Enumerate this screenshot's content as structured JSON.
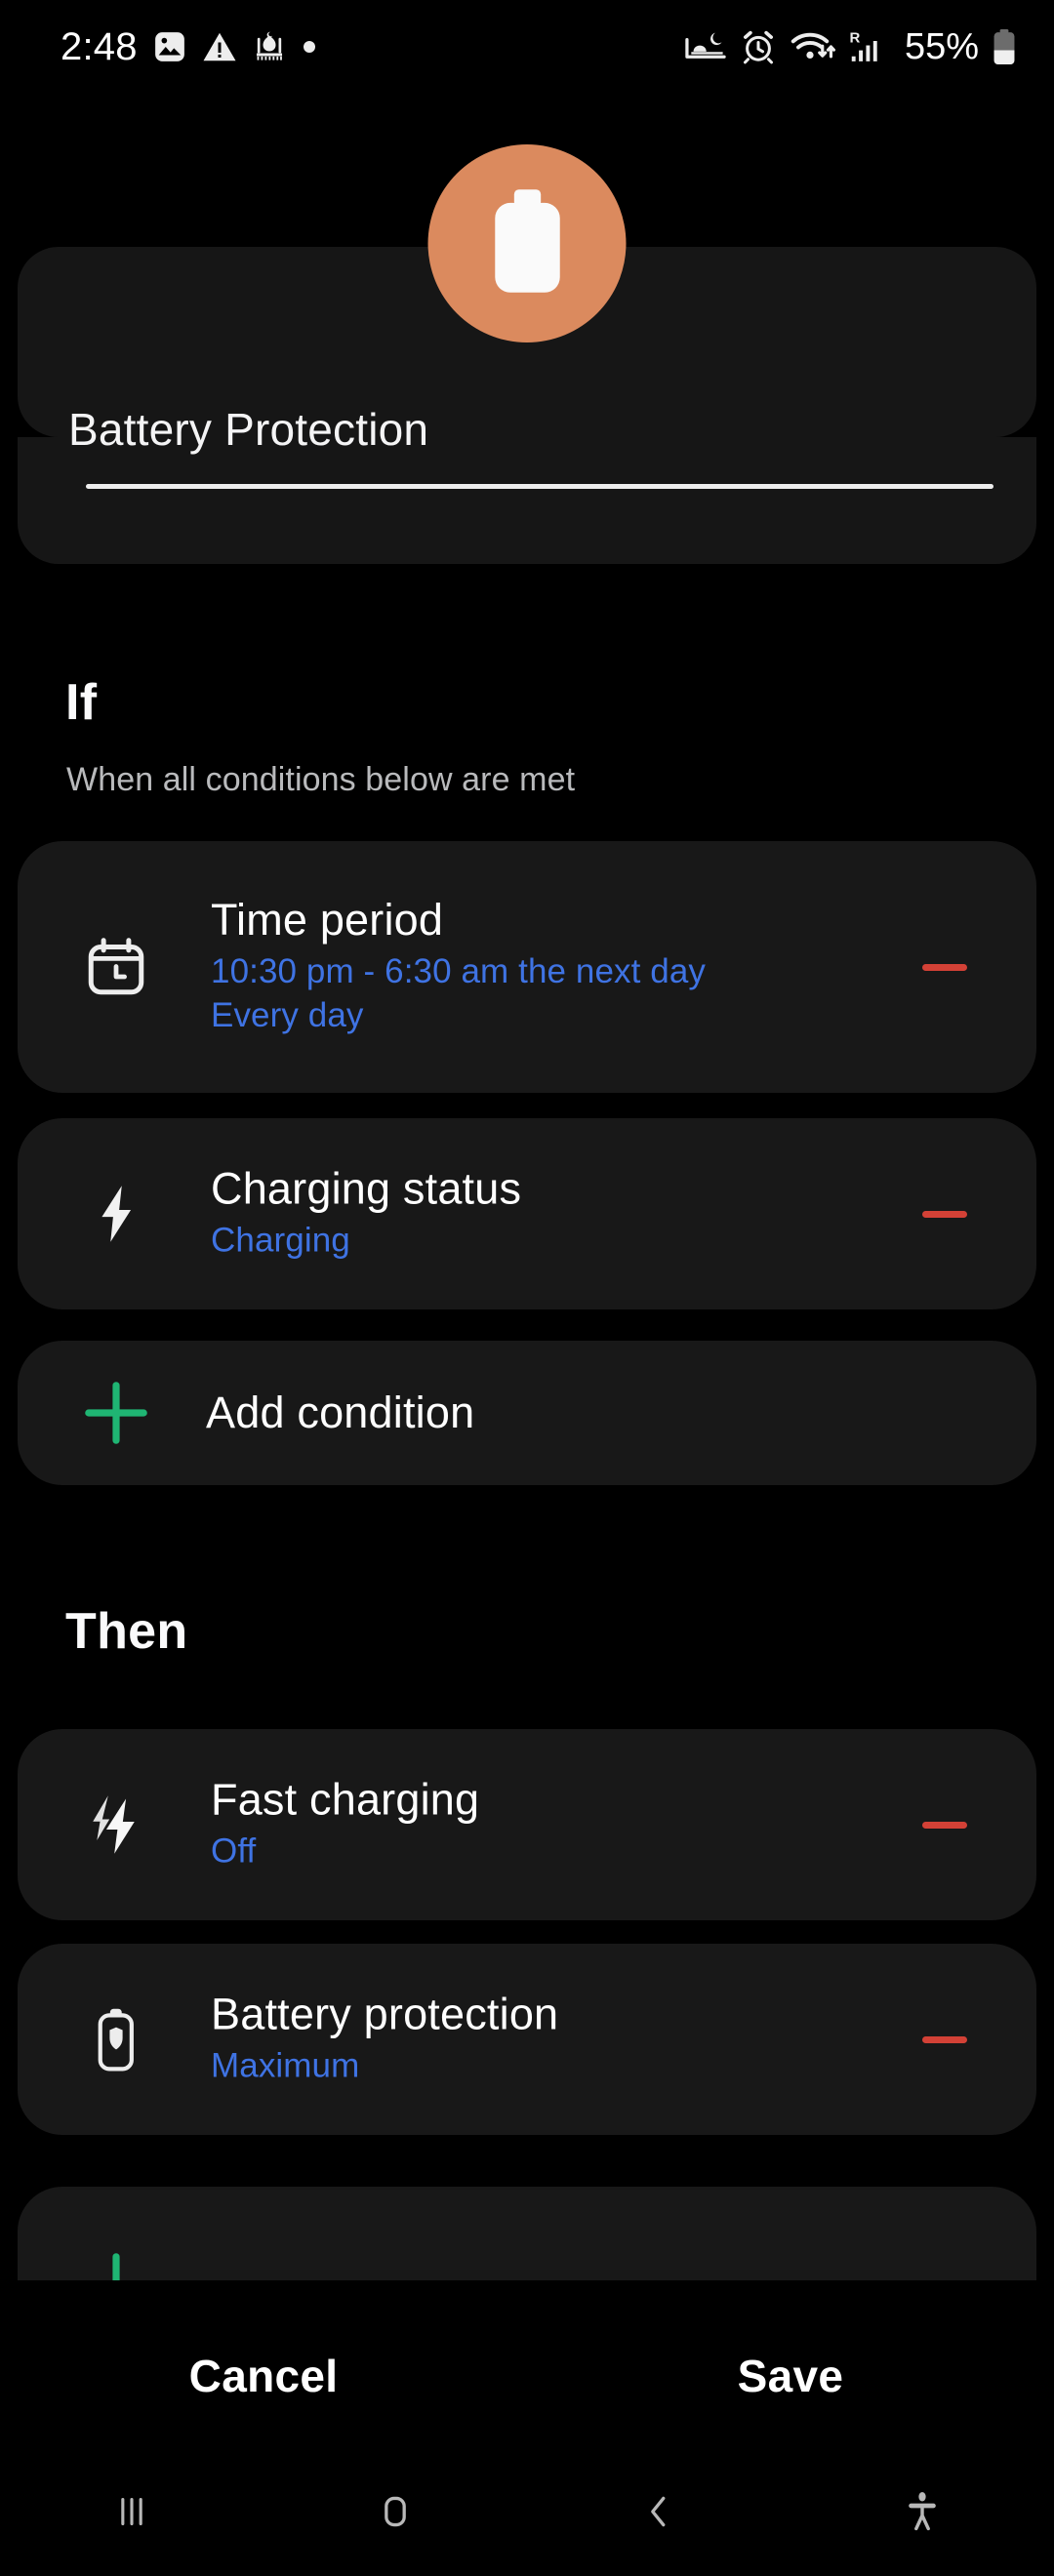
{
  "status_bar": {
    "time": "2:48",
    "battery_percent": "55%",
    "left_icons": [
      "photo-icon",
      "warning-triangle-icon",
      "mosque-icon",
      "dot-icon"
    ],
    "right_icons": [
      "bedtime-icon",
      "alarm-icon",
      "wifi-icon",
      "roaming-signal-icon",
      "battery-icon"
    ]
  },
  "header": {
    "avatar_icon": "battery-icon",
    "avatar_color": "#DB8A5E",
    "title": "Battery Protection"
  },
  "if_section": {
    "heading": "If",
    "subtitle": "When all conditions below are met",
    "conditions": [
      {
        "icon": "calendar-clock-icon",
        "title": "Time period",
        "value_line1": "10:30  pm - 6:30  am the next day",
        "value_line2": "Every day",
        "remove_label": "remove"
      },
      {
        "icon": "bolt-icon",
        "title": "Charging status",
        "value_line1": "Charging",
        "value_line2": "",
        "remove_label": "remove"
      }
    ],
    "add_label": "Add condition",
    "add_icon": "plus-icon"
  },
  "then_section": {
    "heading": "Then",
    "actions": [
      {
        "icon": "double-bolt-icon",
        "title": "Fast charging",
        "value_line1": "Off",
        "value_line2": "",
        "remove_label": "remove"
      },
      {
        "icon": "battery-protection-icon",
        "title": "Battery protection",
        "value_line1": "Maximum",
        "value_line2": "",
        "remove_label": "remove"
      }
    ],
    "add_label": "",
    "add_icon": "plus-icon"
  },
  "footer": {
    "cancel_label": "Cancel",
    "save_label": "Save"
  },
  "nav_bar": {
    "recents_label": "recents-icon",
    "home_label": "home-icon",
    "back_label": "back-icon",
    "accessibility_label": "accessibility-icon"
  },
  "colors": {
    "accent_orange": "#DB8A5E",
    "link_blue": "#3F73E3",
    "remove_red": "#D34136",
    "add_green": "#1FB573",
    "card_bg": "#181818",
    "page_bg": "#000000"
  }
}
